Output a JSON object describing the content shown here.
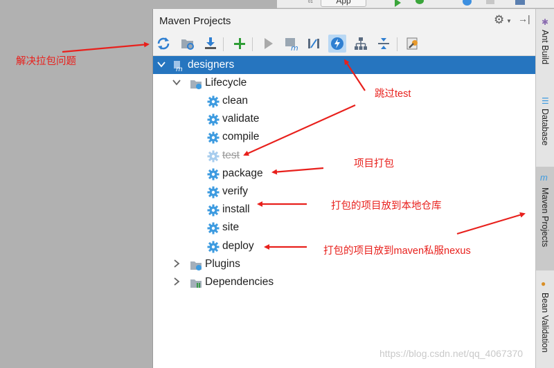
{
  "ide_top": {
    "run_config": "App",
    "tiny_label": "01"
  },
  "panel": {
    "title": "Maven Projects",
    "toolbar": [
      {
        "name": "reimport-button",
        "icon": "refresh-icon"
      },
      {
        "name": "generate-sources-button",
        "icon": "folder-refresh-icon"
      },
      {
        "name": "download-sources-button",
        "icon": "download-icon"
      },
      {
        "name": "add-project-button",
        "icon": "plus-icon"
      },
      {
        "name": "run-build-button",
        "icon": "run-icon"
      },
      {
        "name": "execute-goal-button",
        "icon": "maven-goal-icon"
      },
      {
        "name": "toggle-offline-button",
        "icon": "offline-icon"
      },
      {
        "name": "skip-tests-button",
        "icon": "lightning-icon",
        "selected": true
      },
      {
        "name": "show-dependencies-button",
        "icon": "hierarchy-icon"
      },
      {
        "name": "collapse-all-button",
        "icon": "collapse-icon"
      },
      {
        "name": "settings-button",
        "icon": "wrench-icon"
      }
    ],
    "tree": {
      "project": "designers",
      "lifecycle": "Lifecycle",
      "goals": [
        "clean",
        "validate",
        "compile",
        "test",
        "package",
        "verify",
        "install",
        "site",
        "deploy"
      ],
      "plugins": "Plugins",
      "dependencies": "Dependencies"
    }
  },
  "right_strip": {
    "tabs": [
      "Ant Build",
      "Database",
      "Maven Projects",
      "Bean Validation"
    ]
  },
  "annotations": {
    "reimport": "解决拉包问题",
    "skip_test": "跳过test",
    "package": "项目打包",
    "install": "打包的项目放到本地仓库",
    "deploy": "打包的项目放到maven私服nexus"
  },
  "watermark": "https://blog.csdn.net/qq_4067370",
  "colors": {
    "accent": "#2675bf",
    "annotation": "#e8201c",
    "gear": "#3d9be0"
  }
}
